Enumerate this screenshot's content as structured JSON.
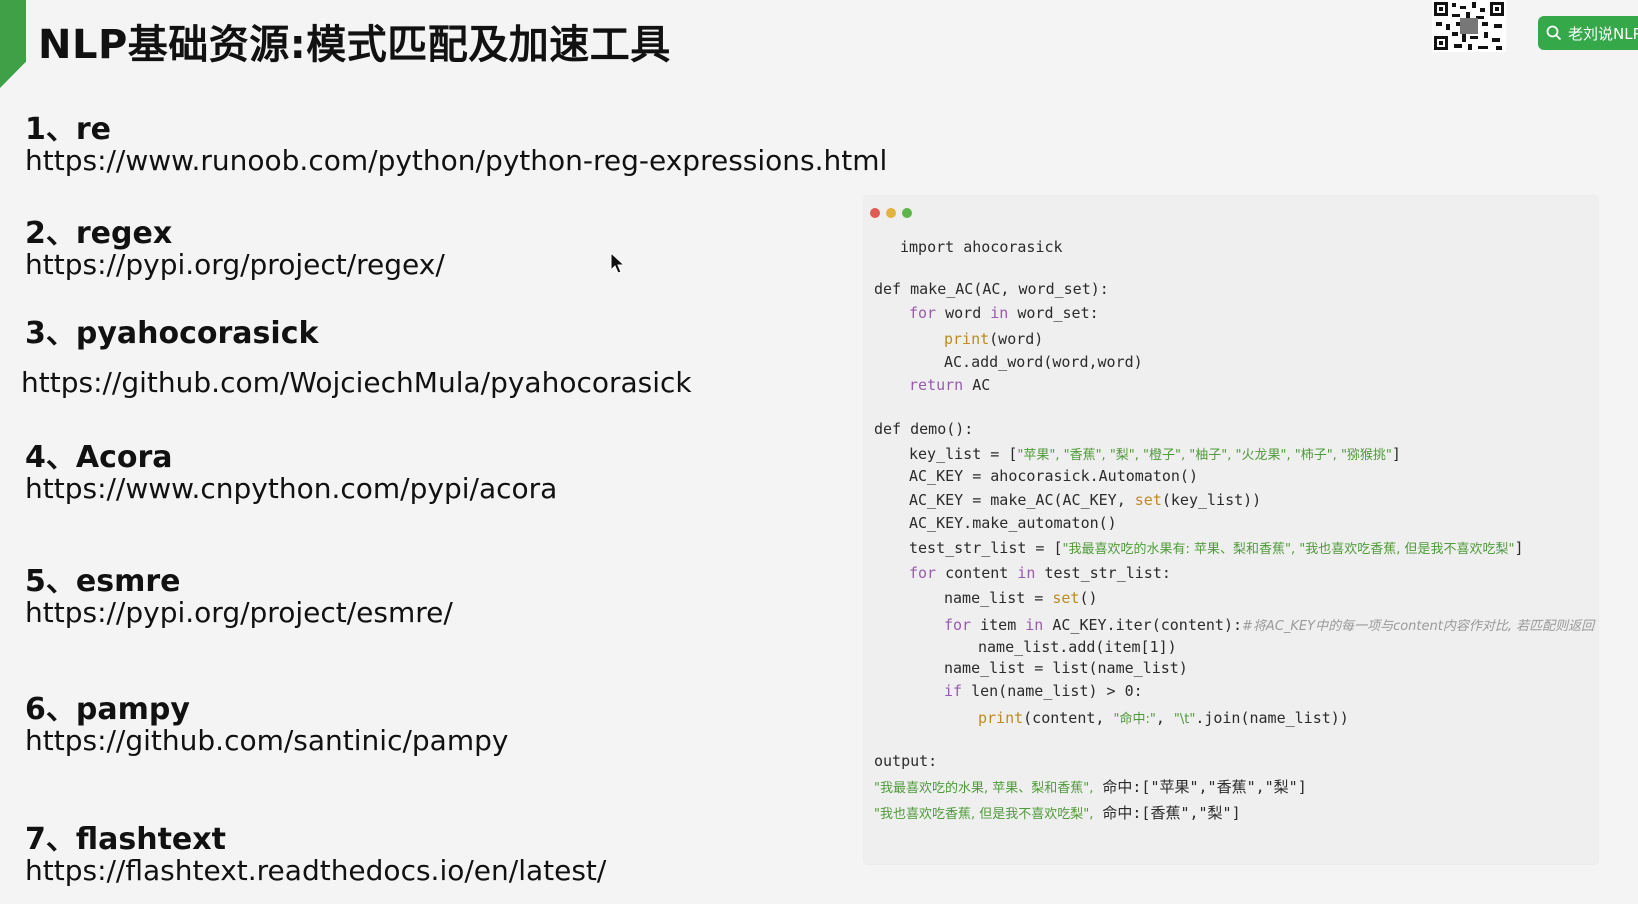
{
  "header": {
    "title": "NLP基础资源:模式匹配及加速工具",
    "brand_button": "老刘说NLP",
    "accent_color": "#3fa048"
  },
  "resources": [
    {
      "title": "1、re",
      "url": "https://www.runoob.com/python/python-reg-expressions.html"
    },
    {
      "title": "2、regex",
      "url": "https://pypi.org/project/regex/"
    },
    {
      "title": "3、pyahocorasick",
      "url": "https://github.com/WojciechMula/pyahocorasick"
    },
    {
      "title": "4、Acora",
      "url": "https://www.cnpython.com/pypi/acora"
    },
    {
      "title": "5、esmre",
      "url": "https://pypi.org/project/esmre/"
    },
    {
      "title": "6、pampy",
      "url": "https://github.com/santinic/pampy"
    },
    {
      "title": "7、flashtext",
      "url": "https://flashtext.readthedocs.io/en/latest/"
    }
  ],
  "code": {
    "window_dots": [
      "#e05b52",
      "#e2b33f",
      "#5db54b"
    ],
    "import_line": "import ahocorasick",
    "def1": "def make_AC(AC, word_set):",
    "kw_for": "for",
    "for1_a": " word ",
    "kw_in": "in",
    "for1_b": " word_set:",
    "fn_print": "print",
    "print1_arg": "(word)",
    "add_word": "AC.add_word(word,word)",
    "kw_return": "return",
    "return_val": " AC",
    "def2": "def demo():",
    "key_list_a": "key_list = [",
    "key_list_items": "\"苹果\", \"香蕉\", \"梨\", \"橙子\", \"柚子\", \"火龙果\", \"柿子\", \"猕猴挑\"",
    "key_list_b": "]",
    "ackey1": "AC_KEY = ahocorasick.Automaton()",
    "ackey2_a": "AC_KEY = make_AC(AC_KEY, ",
    "fn_set": "set",
    "ackey2_b": "(key_list))",
    "make_auto": "AC_KEY.make_automaton()",
    "test_a": "test_str_list = [",
    "test_items": "\"我最喜欢吃的水果有: 苹果、梨和香蕉\", \"我也喜欢吃香蕉, 但是我不喜欢吃梨\"",
    "test_b": "]",
    "for2_a": " content ",
    "for2_b": " test_str_list:",
    "name_list_a": "name_list = ",
    "name_list_b": "()",
    "for3_a": " item ",
    "for3_b": " AC_KEY.iter(content):",
    "for3_comment": "#将AC_KEY中的每一项与content内容作对比, 若匹配则返回",
    "name_add": "name_list.add(item[1])",
    "name_list2": "name_list = list(name_list)",
    "kw_if": "if",
    "if_cond": " len(name_list) > 0:",
    "print2_a": "(content, ",
    "print2_str1": "\"命中:\"",
    "print2_mid": ", ",
    "print2_str2": "\"\\t\"",
    "print2_b": ".join(name_list))",
    "output_label": "output:",
    "out1_str": "\"我最喜欢吃的水果, 苹果、梨和香蕉\",",
    "out1_b": " 命中:[\"苹果\",\"香蕉\",\"梨\"]",
    "out2_str": "\"我也喜欢吃香蕉, 但是我不喜欢吃梨\",",
    "out2_b": " 命中:[香蕉\",\"梨\"]"
  }
}
